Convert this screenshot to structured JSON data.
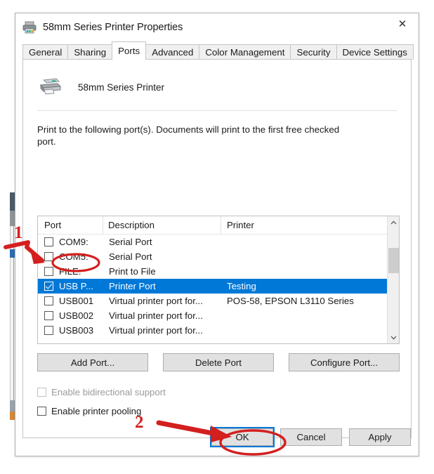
{
  "window": {
    "title": "58mm Series Printer Properties",
    "title_icon": "printer-icon",
    "close_label": "✕"
  },
  "tabs": [
    {
      "label": "General",
      "active": false
    },
    {
      "label": "Sharing",
      "active": false
    },
    {
      "label": "Ports",
      "active": true
    },
    {
      "label": "Advanced",
      "active": false
    },
    {
      "label": "Color Management",
      "active": false
    },
    {
      "label": "Security",
      "active": false
    },
    {
      "label": "Device Settings",
      "active": false
    }
  ],
  "printer": {
    "icon": "printer-icon",
    "name": "58mm Series Printer"
  },
  "instructions": "Print to the following port(s). Documents will print to the first free checked port.",
  "port_table": {
    "columns": [
      "Port",
      "Description",
      "Printer"
    ],
    "rows": [
      {
        "checked": false,
        "selected": false,
        "port": "COM9:",
        "description": "Serial Port",
        "printer": ""
      },
      {
        "checked": false,
        "selected": false,
        "port": "COM5:",
        "description": "Serial Port",
        "printer": ""
      },
      {
        "checked": false,
        "selected": false,
        "port": "FILE:",
        "description": "Print to File",
        "printer": ""
      },
      {
        "checked": true,
        "selected": true,
        "port": "USB P...",
        "description": "Printer Port",
        "printer": "Testing"
      },
      {
        "checked": false,
        "selected": false,
        "port": "USB001",
        "description": "Virtual printer port for...",
        "printer": "POS-58, EPSON L3110 Series"
      },
      {
        "checked": false,
        "selected": false,
        "port": "USB002",
        "description": "Virtual printer port for...",
        "printer": ""
      },
      {
        "checked": false,
        "selected": false,
        "port": "USB003",
        "description": "Virtual printer port for...",
        "printer": ""
      }
    ],
    "scroll_up_icon": "chevron-up-icon",
    "scroll_down_icon": "chevron-down-icon",
    "selection_color": "#0078d7"
  },
  "port_buttons": {
    "add": "Add Port...",
    "delete": "Delete Port",
    "configure": "Configure Port..."
  },
  "options": {
    "bidirectional": {
      "label": "Enable bidirectional support",
      "checked": false,
      "disabled": true
    },
    "pooling": {
      "label": "Enable printer pooling",
      "checked": false,
      "disabled": false
    }
  },
  "footer_buttons": {
    "ok": "OK",
    "cancel": "Cancel",
    "apply": "Apply"
  },
  "annotations": {
    "marker_1": "1",
    "marker_2": "2",
    "color": "#d41f1f"
  }
}
